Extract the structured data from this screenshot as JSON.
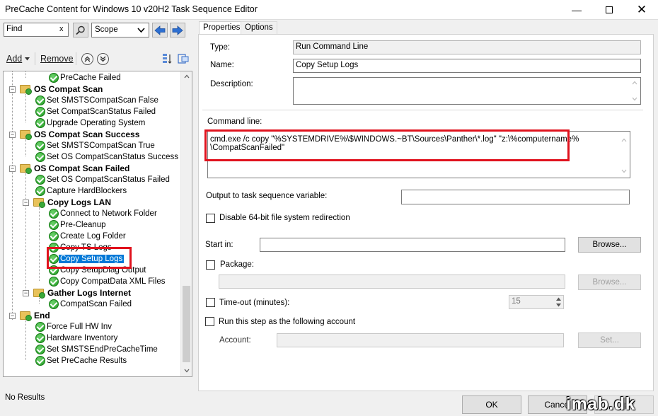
{
  "window": {
    "title": "PreCache Content for Windows 10 v20H2 Task Sequence Editor"
  },
  "toolbar": {
    "find_value": "Find",
    "clear_label": "x",
    "scope_value": "Scope",
    "add_label": "Add",
    "remove_label": "Remove"
  },
  "tree": {
    "items": [
      "PreCache Failed",
      "OS Compat Scan",
      "Set SMSTSCompatScan False",
      "Set CompatScanStatus Failed",
      "Upgrade Operating System",
      "OS Compat Scan Success",
      "Set SMSTSCompatScan True",
      "Set OS CompatScanStatus Success",
      "OS Compat Scan Failed",
      "Set OS CompatScanStatus Failed",
      "Capture HardBlockers",
      "Copy Logs LAN",
      "Connect to Network Folder",
      "Pre-Cleanup",
      "Create Log Folder",
      "Copy TS Logs",
      "Copy Setup Logs",
      "Copy SetupDiag Output",
      "Copy CompatData XML Files",
      "Gather Logs Internet",
      "CompatScan Failed",
      "End",
      "Force Full HW Inv",
      "Hardware Inventory",
      "Set SMSTSEndPreCacheTime",
      "Set PreCache Results"
    ]
  },
  "tabs": [
    "Properties",
    "Options"
  ],
  "properties": {
    "type_label": "Type:",
    "type_value": "Run Command Line",
    "name_label": "Name:",
    "name_value": "Copy Setup Logs",
    "description_label": "Description:",
    "description_value": "",
    "command_label": "Command line:",
    "command_value": "cmd.exe /c copy \"%SYSTEMDRIVE%\\$WINDOWS.~BT\\Sources\\Panther\\*.log\" \"z:\\%computername%\\CompatScanFailed\"",
    "command_line1": "cmd.exe /c copy \"%SYSTEMDRIVE%\\$WINDOWS.~BT\\Sources\\Panther\\*.log\" \"z:\\%computername%",
    "command_line2": "\\CompatScanFailed\"",
    "output_var_label": "Output to task sequence variable:",
    "output_var_value": "",
    "disable64_label": "Disable 64-bit file system redirection",
    "startin_label": "Start in:",
    "startin_value": "",
    "browse_label": "Browse...",
    "package_label": "Package:",
    "package_value": "",
    "browse2_label": "Browse...",
    "timeout_label": "Time-out (minutes):",
    "timeout_value": "15",
    "runas_label": "Run this step as the following account",
    "account_label": "Account:",
    "account_value": "",
    "set_label": "Set..."
  },
  "status": {
    "text": "No Results"
  },
  "footer": {
    "ok_label": "OK",
    "cancel_label": "Cancel",
    "apply_label": "Apply",
    "watermark": "imab.dk"
  },
  "colors": {
    "selection": "#0078d7",
    "highlight_box": "#e0121d",
    "success": "#1e9a1e"
  },
  "icons": [
    "search-icon",
    "arrow-left-icon",
    "arrow-right-icon",
    "move-up-icon",
    "move-down-icon",
    "checkmark-icon",
    "folder-icon"
  ]
}
